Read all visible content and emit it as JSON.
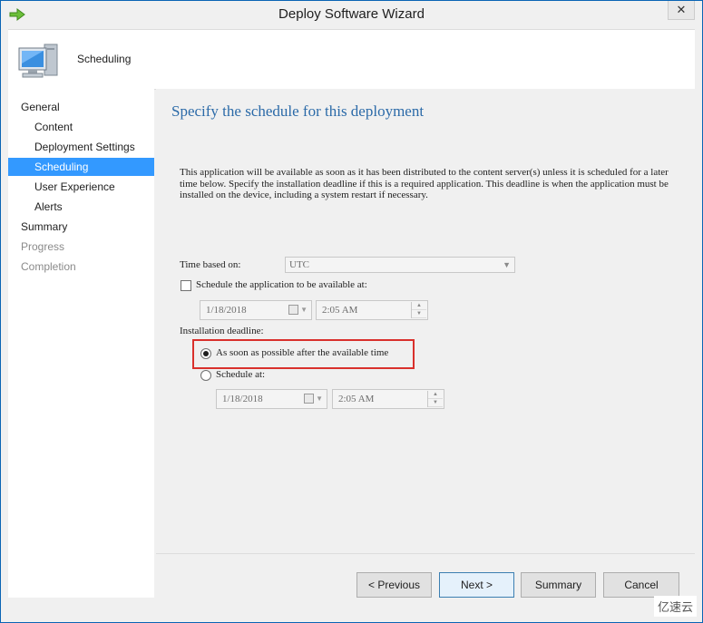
{
  "window": {
    "title": "Deploy Software Wizard",
    "close_glyph": "✕"
  },
  "header": {
    "title": "Scheduling",
    "icon": "computer-icon"
  },
  "sidebar": {
    "items": [
      {
        "label": "General",
        "state": "normal",
        "level": "top"
      },
      {
        "label": "Content",
        "state": "normal",
        "level": "sub"
      },
      {
        "label": "Deployment Settings",
        "state": "normal",
        "level": "sub"
      },
      {
        "label": "Scheduling",
        "state": "active",
        "level": "sub"
      },
      {
        "label": "User Experience",
        "state": "normal",
        "level": "sub"
      },
      {
        "label": "Alerts",
        "state": "normal",
        "level": "sub"
      },
      {
        "label": "Summary",
        "state": "normal",
        "level": "top"
      },
      {
        "label": "Progress",
        "state": "disabled",
        "level": "top"
      },
      {
        "label": "Completion",
        "state": "disabled",
        "level": "top"
      }
    ]
  },
  "main": {
    "heading": "Specify the schedule for this deployment",
    "description": "This application will be available as soon as it has been distributed to the content server(s) unless it is scheduled for a later time below. Specify the installation deadline if this is a required application. This deadline is when the application must be installed on the device, including a system restart if necessary.",
    "time_based_on": {
      "label": "Time based on:",
      "value": "UTC"
    },
    "schedule_available": {
      "label": "Schedule the application to be available at:",
      "checked": false,
      "date": "1/18/2018",
      "time": "2:05 AM"
    },
    "deadline": {
      "label": "Installation deadline:",
      "asap_label": "As soon as possible after the available time",
      "schedule_at_label": "Schedule at:",
      "selected": "asap",
      "date": "1/18/2018",
      "time": "2:05 AM"
    }
  },
  "buttons": {
    "previous": "< Previous",
    "next": "Next >",
    "summary": "Summary",
    "cancel": "Cancel"
  },
  "watermark": {
    "text": "亿速云"
  },
  "colors": {
    "accent": "#3399ff",
    "heading": "#2b6aa8",
    "highlight": "#d9302c"
  }
}
